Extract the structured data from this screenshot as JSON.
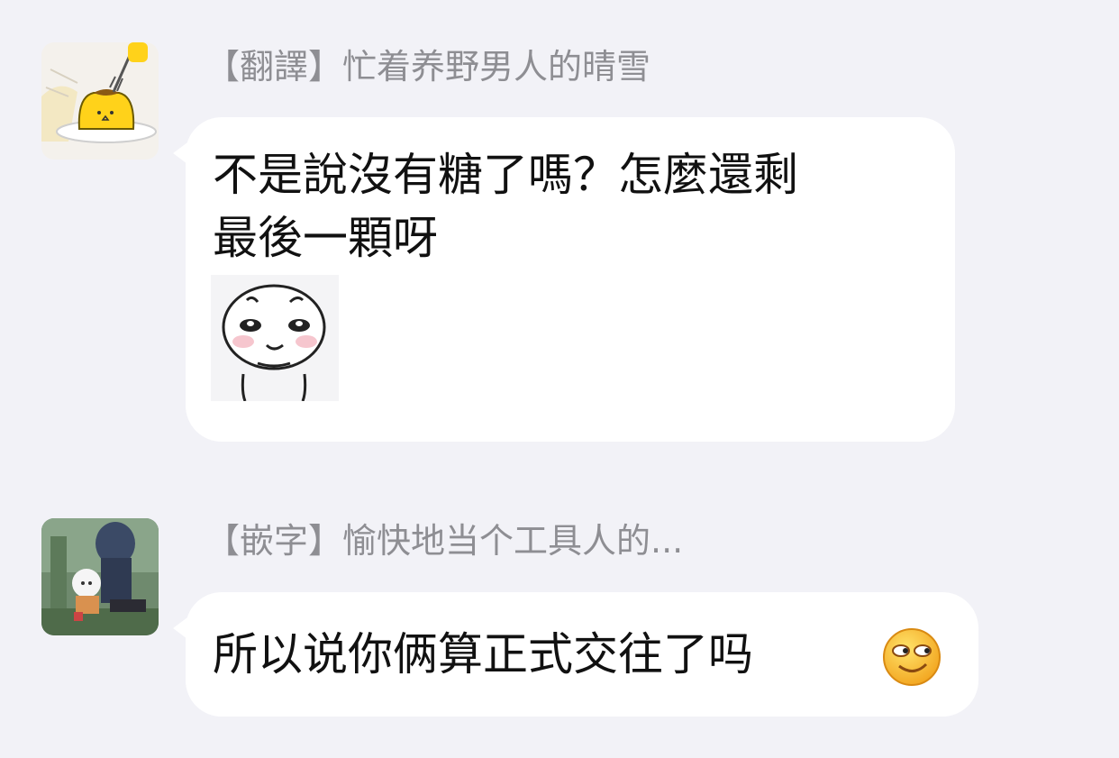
{
  "messages": [
    {
      "tag": "【翻譯】",
      "sender": "忙着养野男人的晴雪",
      "text_line1": "不是說沒有糖了嗎？怎麼還剩",
      "text_line2": "最後一顆呀",
      "avatar_icon": "pudding-avatar-icon",
      "sticker_icon": "shy-blushing-sticker"
    },
    {
      "tag": "【嵌字】",
      "sender": "愉快地当个工具人的...",
      "text": "所以说你俩算正式交往了吗",
      "avatar_icon": "anime-characters-avatar-icon",
      "emoji_icon": "smirk-emoji-icon"
    }
  ],
  "colors": {
    "background": "#f2f2f7",
    "bubble": "#ffffff",
    "sender_text": "#8e8e93",
    "message_text": "#111111"
  }
}
